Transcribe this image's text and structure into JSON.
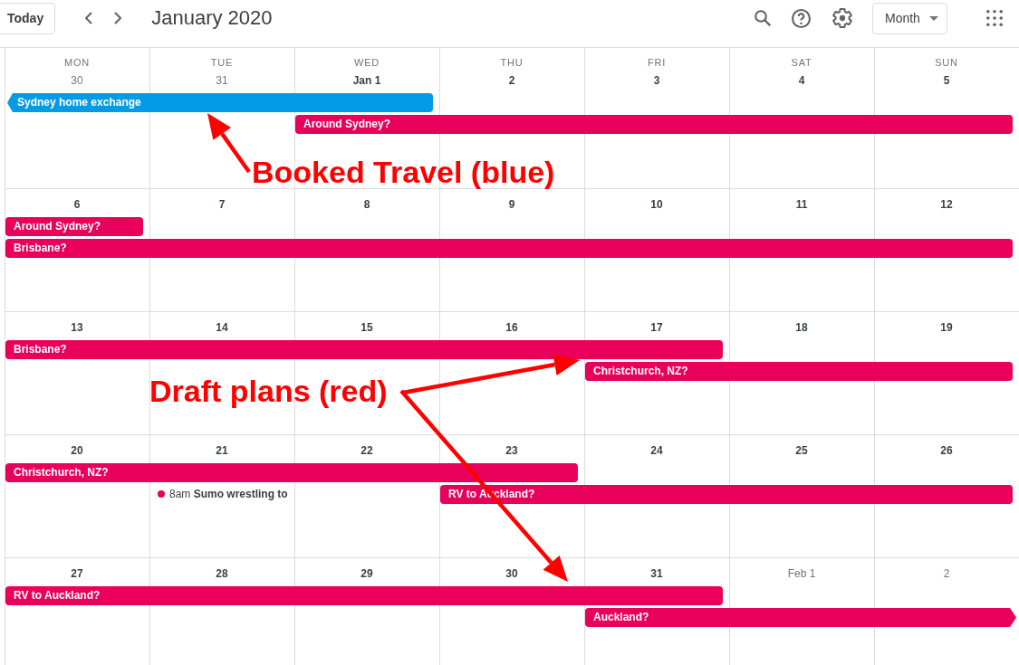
{
  "header": {
    "today_button": "Today",
    "title": "January 2020",
    "view_selector": "Month"
  },
  "calendar": {
    "weekdays": [
      "MON",
      "TUE",
      "WED",
      "THU",
      "FRI",
      "SAT",
      "SUN"
    ],
    "weeks": [
      {
        "days": [
          {
            "date": "30",
            "in_month": false
          },
          {
            "date": "31",
            "in_month": false
          },
          {
            "date": "Jan 1",
            "in_month": true
          },
          {
            "date": "2",
            "in_month": true
          },
          {
            "date": "3",
            "in_month": true
          },
          {
            "date": "4",
            "in_month": true
          },
          {
            "date": "5",
            "in_month": true
          }
        ],
        "lanes": [
          {
            "slots": [
              {
                "kind": "bar",
                "title": "Sydney home exchange",
                "color": "#039be5",
                "continues_before": true,
                "continues_after": false
              },
              {
                "kind": "continued"
              },
              {
                "kind": "continued"
              }
            ]
          },
          {
            "slots": [
              {
                "kind": "gap"
              },
              {
                "kind": "gap"
              },
              {
                "kind": "bar",
                "title": "Around Sydney?",
                "color": "#e8005a",
                "continues_before": false,
                "continues_after": false
              },
              {
                "kind": "continued"
              },
              {
                "kind": "continued"
              },
              {
                "kind": "continued"
              },
              {
                "kind": "continued"
              }
            ]
          }
        ]
      },
      {
        "days": [
          {
            "date": "6",
            "in_month": true
          },
          {
            "date": "7",
            "in_month": true
          },
          {
            "date": "8",
            "in_month": true
          },
          {
            "date": "9",
            "in_month": true
          },
          {
            "date": "10",
            "in_month": true
          },
          {
            "date": "11",
            "in_month": true
          },
          {
            "date": "12",
            "in_month": true
          }
        ],
        "lanes": [
          {
            "slots": [
              {
                "kind": "bar",
                "title": "Around Sydney?",
                "color": "#e8005a",
                "continues_before": false,
                "continues_after": false
              }
            ]
          },
          {
            "slots": [
              {
                "kind": "bar",
                "title": "Brisbane?",
                "color": "#e8005a",
                "continues_before": false,
                "continues_after": false
              },
              {
                "kind": "continued"
              },
              {
                "kind": "continued"
              },
              {
                "kind": "continued"
              },
              {
                "kind": "continued"
              },
              {
                "kind": "continued"
              },
              {
                "kind": "continued"
              }
            ]
          }
        ]
      },
      {
        "days": [
          {
            "date": "13",
            "in_month": true
          },
          {
            "date": "14",
            "in_month": true
          },
          {
            "date": "15",
            "in_month": true
          },
          {
            "date": "16",
            "in_month": true
          },
          {
            "date": "17",
            "in_month": true
          },
          {
            "date": "18",
            "in_month": true
          },
          {
            "date": "19",
            "in_month": true
          }
        ],
        "lanes": [
          {
            "slots": [
              {
                "kind": "bar",
                "title": "Brisbane?",
                "color": "#e8005a",
                "continues_before": false,
                "continues_after": false
              },
              {
                "kind": "continued"
              },
              {
                "kind": "continued"
              },
              {
                "kind": "continued"
              },
              {
                "kind": "continued"
              }
            ]
          },
          {
            "slots": [
              {
                "kind": "gap"
              },
              {
                "kind": "gap"
              },
              {
                "kind": "gap"
              },
              {
                "kind": "gap"
              },
              {
                "kind": "bar",
                "title": "Christchurch, NZ?",
                "color": "#e8005a",
                "continues_before": false,
                "continues_after": false
              },
              {
                "kind": "continued"
              },
              {
                "kind": "continued"
              }
            ]
          }
        ]
      },
      {
        "days": [
          {
            "date": "20",
            "in_month": true
          },
          {
            "date": "21",
            "in_month": true
          },
          {
            "date": "22",
            "in_month": true
          },
          {
            "date": "23",
            "in_month": true
          },
          {
            "date": "24",
            "in_month": true
          },
          {
            "date": "25",
            "in_month": true
          },
          {
            "date": "26",
            "in_month": true
          }
        ],
        "lanes": [
          {
            "slots": [
              {
                "kind": "bar",
                "title": "Christchurch, NZ?",
                "color": "#e8005a",
                "continues_before": false,
                "continues_after": false
              },
              {
                "kind": "continued"
              },
              {
                "kind": "continued"
              },
              {
                "kind": "continued"
              }
            ]
          },
          {
            "slots": [
              {
                "kind": "gap"
              },
              {
                "kind": "timed",
                "time": "8am",
                "title": "Sumo wrestling to",
                "color": "#e8005a"
              },
              {
                "kind": "gap"
              },
              {
                "kind": "bar",
                "title": "RV to Auckland?",
                "color": "#e8005a",
                "continues_before": false,
                "continues_after": false
              },
              {
                "kind": "continued"
              },
              {
                "kind": "continued"
              },
              {
                "kind": "continued"
              }
            ]
          }
        ]
      },
      {
        "days": [
          {
            "date": "27",
            "in_month": true
          },
          {
            "date": "28",
            "in_month": true
          },
          {
            "date": "29",
            "in_month": true
          },
          {
            "date": "30",
            "in_month": true
          },
          {
            "date": "31",
            "in_month": true
          },
          {
            "date": "Feb 1",
            "in_month": false
          },
          {
            "date": "2",
            "in_month": false
          }
        ],
        "lanes": [
          {
            "slots": [
              {
                "kind": "bar",
                "title": "RV to Auckland?",
                "color": "#e8005a",
                "continues_before": false,
                "continues_after": false
              },
              {
                "kind": "continued"
              },
              {
                "kind": "continued"
              },
              {
                "kind": "continued"
              },
              {
                "kind": "continued"
              }
            ]
          },
          {
            "slots": [
              {
                "kind": "gap"
              },
              {
                "kind": "gap"
              },
              {
                "kind": "gap"
              },
              {
                "kind": "gap"
              },
              {
                "kind": "bar",
                "title": "Auckland?",
                "color": "#e8005a",
                "continues_before": false,
                "continues_after": true
              },
              {
                "kind": "continued"
              },
              {
                "kind": "continued"
              }
            ]
          }
        ]
      }
    ]
  },
  "annotations": [
    {
      "text": "Booked Travel (blue)"
    },
    {
      "text": "Draft plans (red)"
    }
  ]
}
